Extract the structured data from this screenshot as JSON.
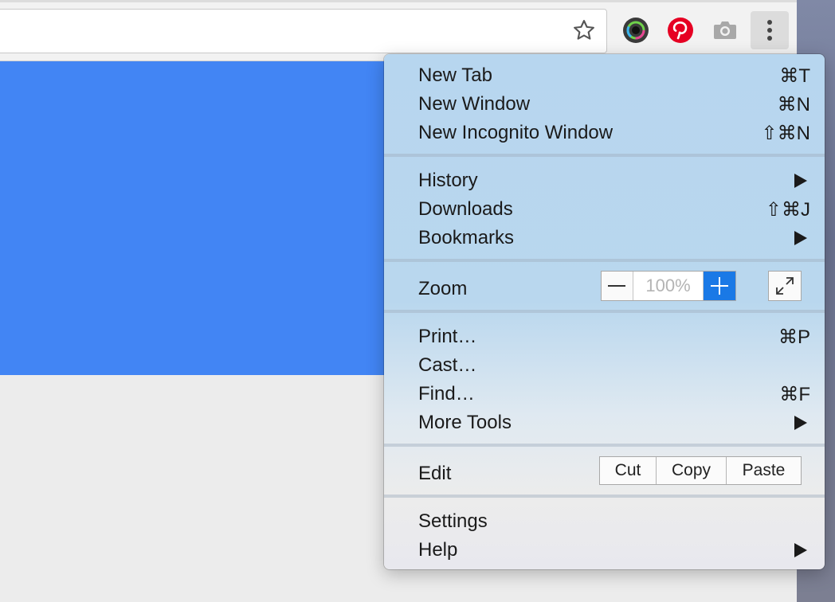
{
  "toolbar": {
    "bookmark_icon": "star-outline-icon",
    "extensions": [
      {
        "name": "lens-extension-icon",
        "color": "#3a3a3a"
      },
      {
        "name": "pinterest-icon",
        "color": "#e60023"
      },
      {
        "name": "camera-icon",
        "color": "#a8a8a8"
      }
    ],
    "menu_icon": "vertical-dots-icon"
  },
  "colors": {
    "page_blue": "#4285f4",
    "zoom_plus": "#1a79e6",
    "menu_text": "#1a1a1a"
  },
  "menu": {
    "group1": [
      {
        "label": "New Tab",
        "shortcut": "⌘T"
      },
      {
        "label": "New Window",
        "shortcut": "⌘N"
      },
      {
        "label": "New Incognito Window",
        "shortcut": "⇧⌘N"
      }
    ],
    "group2": [
      {
        "label": "History",
        "submenu": true
      },
      {
        "label": "Downloads",
        "shortcut": "⇧⌘J"
      },
      {
        "label": "Bookmarks",
        "submenu": true
      }
    ],
    "zoom": {
      "label": "Zoom",
      "minus": "—",
      "value": "100%",
      "plus": "+"
    },
    "group4": [
      {
        "label": "Print…",
        "shortcut": "⌘P"
      },
      {
        "label": "Cast…"
      },
      {
        "label": "Find…",
        "shortcut": "⌘F"
      },
      {
        "label": "More Tools",
        "submenu": true
      }
    ],
    "edit": {
      "label": "Edit",
      "cut": "Cut",
      "copy": "Copy",
      "paste": "Paste"
    },
    "group6": [
      {
        "label": "Settings"
      },
      {
        "label": "Help",
        "submenu": true
      }
    ]
  }
}
